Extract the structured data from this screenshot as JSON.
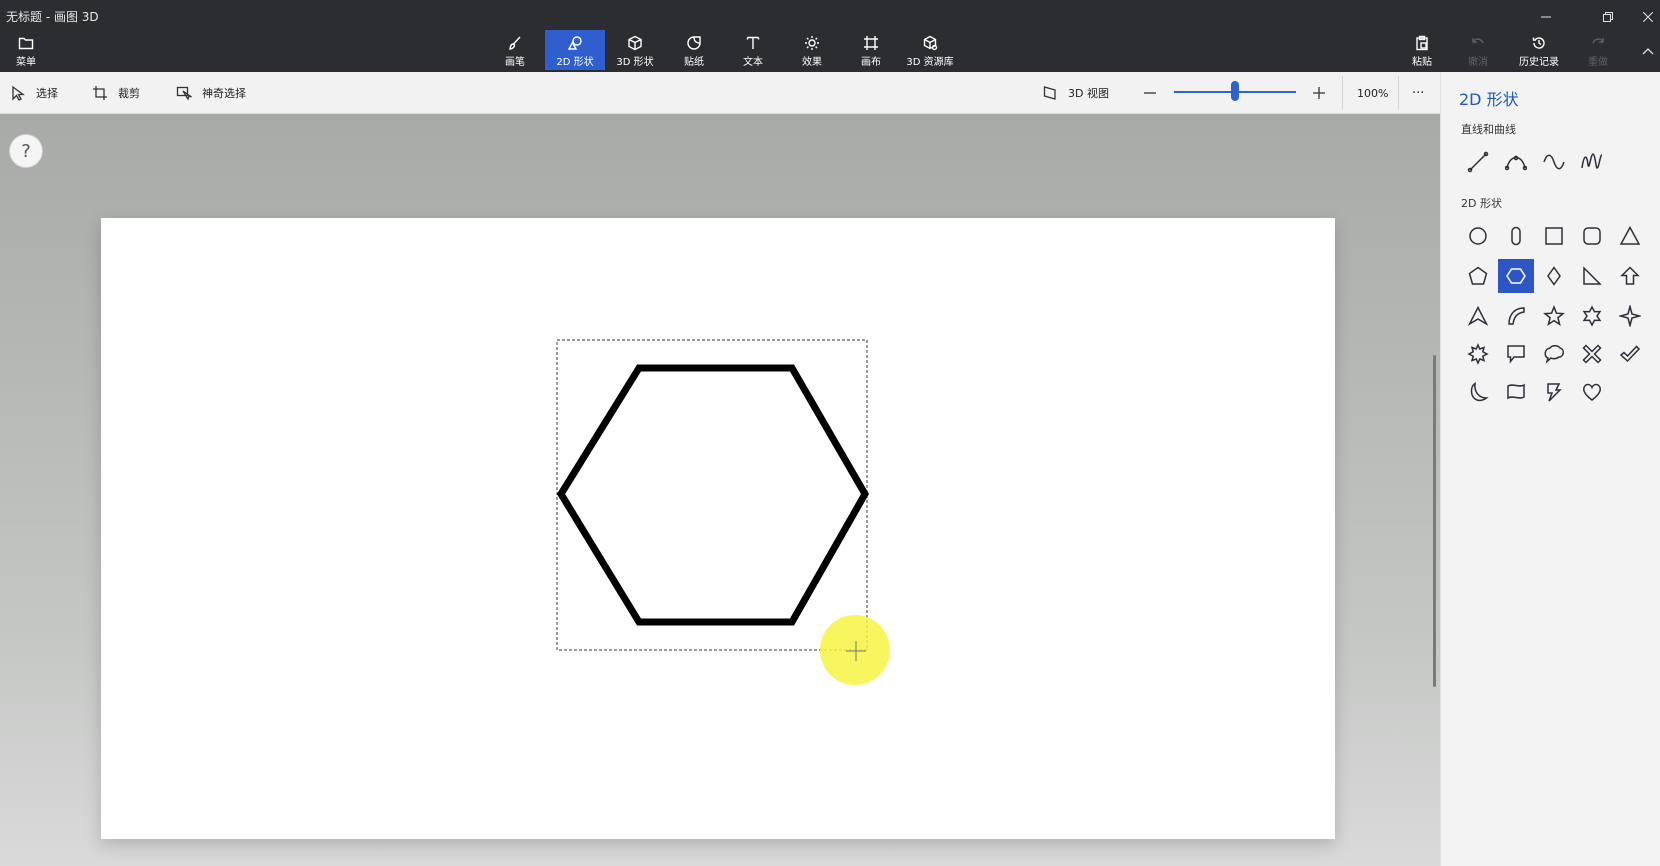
{
  "window": {
    "title": "无标题 - 画图 3D"
  },
  "ribbon": {
    "menu_label": "菜单",
    "tools": [
      {
        "label": "画笔",
        "icon": "brush-icon"
      },
      {
        "label": "2D 形状",
        "icon": "2d-shapes-icon",
        "active": true
      },
      {
        "label": "3D 形状",
        "icon": "3d-shapes-icon"
      },
      {
        "label": "贴纸",
        "icon": "sticker-icon"
      },
      {
        "label": "文本",
        "icon": "text-icon"
      },
      {
        "label": "效果",
        "icon": "effects-icon"
      },
      {
        "label": "画布",
        "icon": "canvas-icon"
      },
      {
        "label": "3D 资源库",
        "icon": "3d-library-icon"
      }
    ],
    "paste_label": "粘贴",
    "undo_label": "撤消",
    "history_label": "历史记录",
    "redo_label": "重做"
  },
  "toolbar": {
    "select_label": "选择",
    "crop_label": "裁剪",
    "magic_select_label": "神奇选择",
    "view3d_label": "3D 视图",
    "zoom_value": "100%",
    "zoom_level": 0.5,
    "more_label": "···"
  },
  "help": {
    "label": "?"
  },
  "panel": {
    "title": "2D 形状",
    "lines_section": "直线和曲线",
    "shapes_section": "2D 形状",
    "lines": [
      "line-icon",
      "curve-icon",
      "wave-curve-icon",
      "zigzag-curve-icon"
    ],
    "shapes": [
      "circle-icon",
      "capsule-icon",
      "square-icon",
      "rounded-square-icon",
      "triangle-icon",
      "pentagon-icon",
      "hexagon-icon",
      "diamond-icon",
      "right-triangle-icon",
      "arrow-up-icon",
      "arrowhead-icon",
      "leaf-icon",
      "star5-icon",
      "star6-icon",
      "star4-icon",
      "starburst-icon",
      "speech-bubble-icon",
      "thought-bubble-icon",
      "cross-icon",
      "check-icon",
      "moon-icon",
      "banner-icon",
      "lightning-icon",
      "heart-icon"
    ],
    "selected_shape": "hexagon-icon",
    "accent_color": "#2d56c4"
  },
  "colors": {
    "ribbon_bg": "#2b2d31",
    "active_tool": "#2f5fcf",
    "panel_title": "#1e5bb8",
    "highlight": "#f6f542"
  }
}
